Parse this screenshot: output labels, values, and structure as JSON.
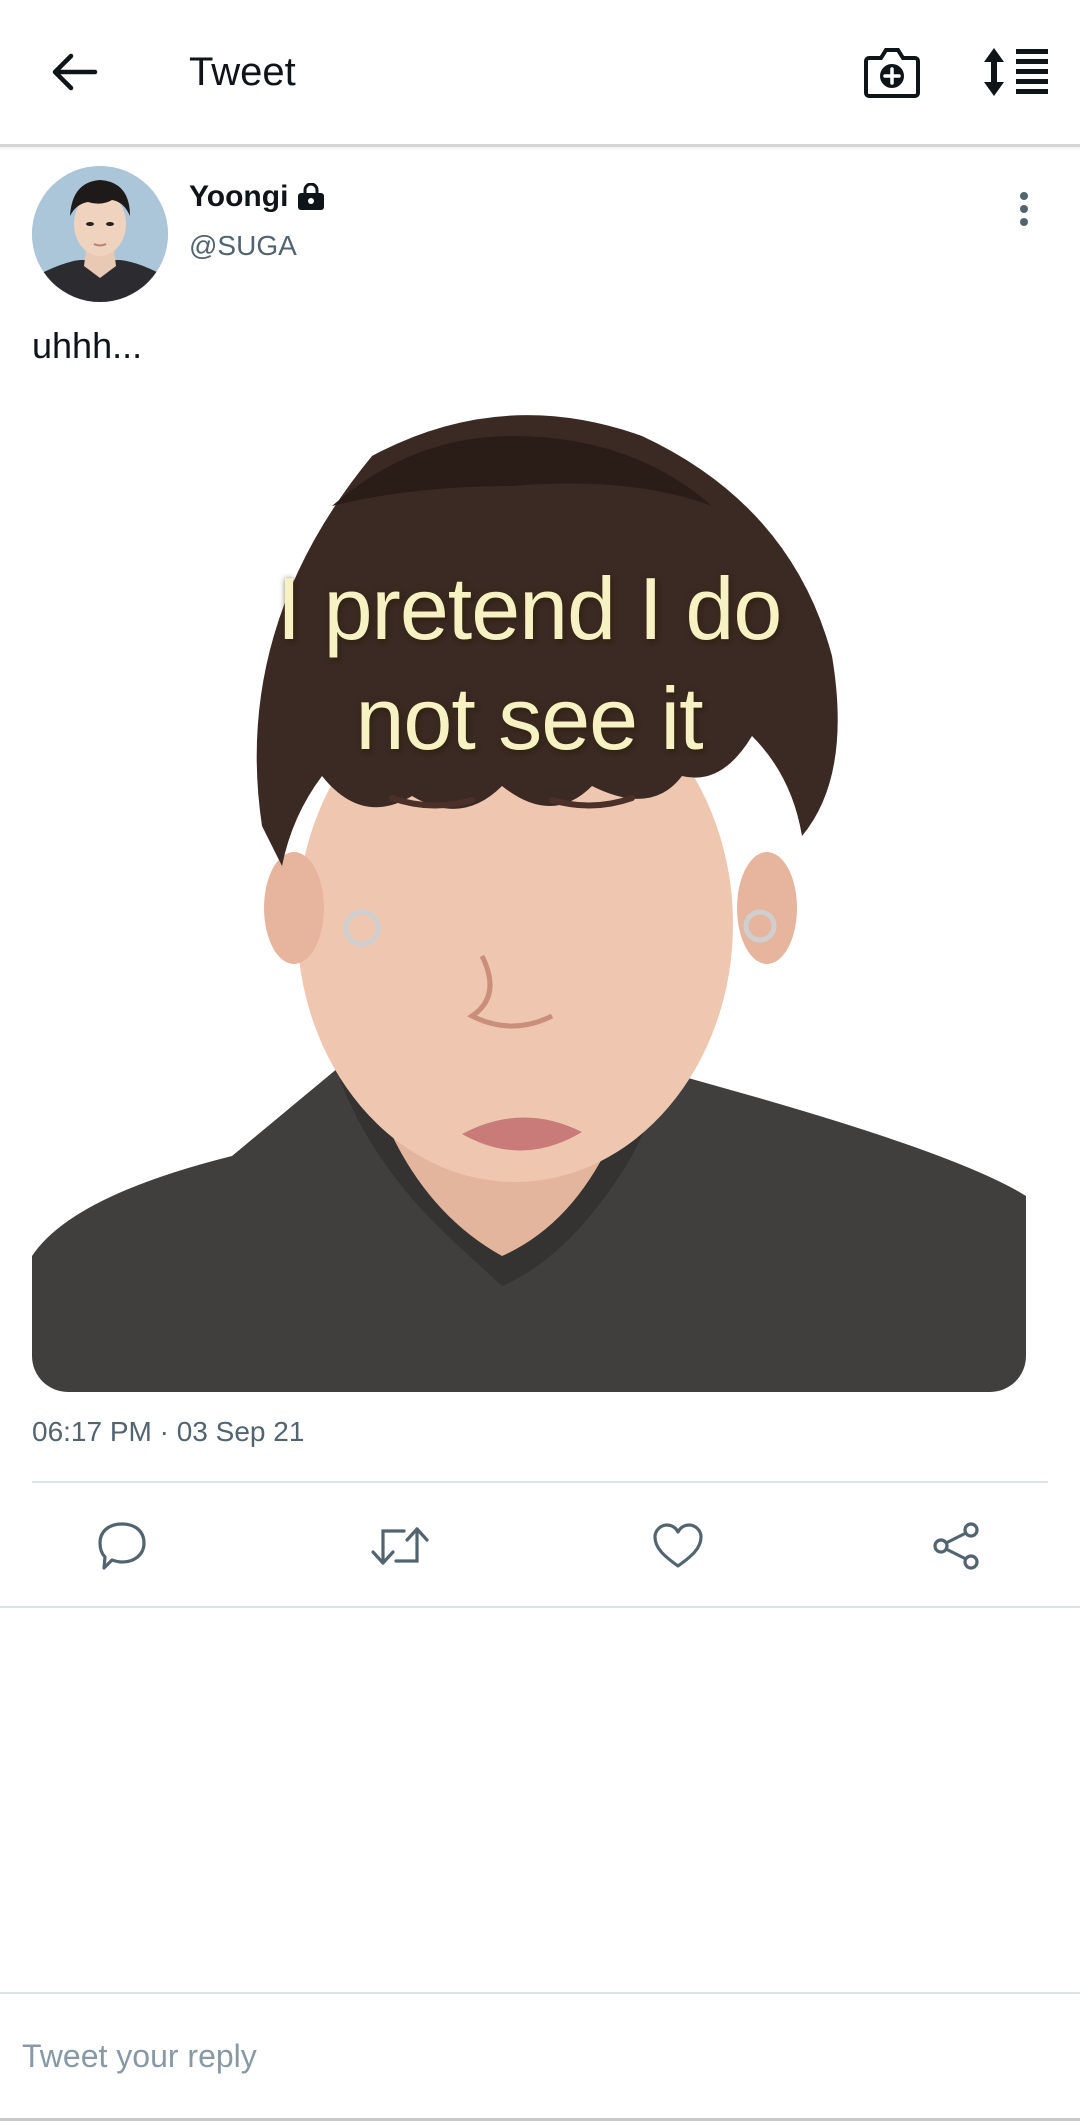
{
  "header": {
    "title": "Tweet",
    "back_icon": "arrow-left-icon",
    "camera_icon": "camera-add-icon",
    "sort_icon": "sort-list-icon"
  },
  "tweet": {
    "author_name": "Yoongi",
    "author_handle": "@SUGA",
    "protected_icon": "lock-icon",
    "more_icon": "more-vertical-icon",
    "text": "uhhh...",
    "media_caption_lines": [
      "I pretend I do",
      "not see it"
    ],
    "timestamp": "06:17 PM · 03 Sep 21"
  },
  "actions": [
    {
      "name": "reply",
      "icon": "reply-icon"
    },
    {
      "name": "retweet",
      "icon": "retweet-icon"
    },
    {
      "name": "like",
      "icon": "heart-icon"
    },
    {
      "name": "share",
      "icon": "share-icon"
    }
  ],
  "reply": {
    "placeholder": "Tweet your reply",
    "value": ""
  },
  "colors": {
    "text_primary": "#0f1419",
    "text_secondary": "#536471",
    "divider": "#dfe3e6",
    "meme_text": "#f7f2c4"
  }
}
